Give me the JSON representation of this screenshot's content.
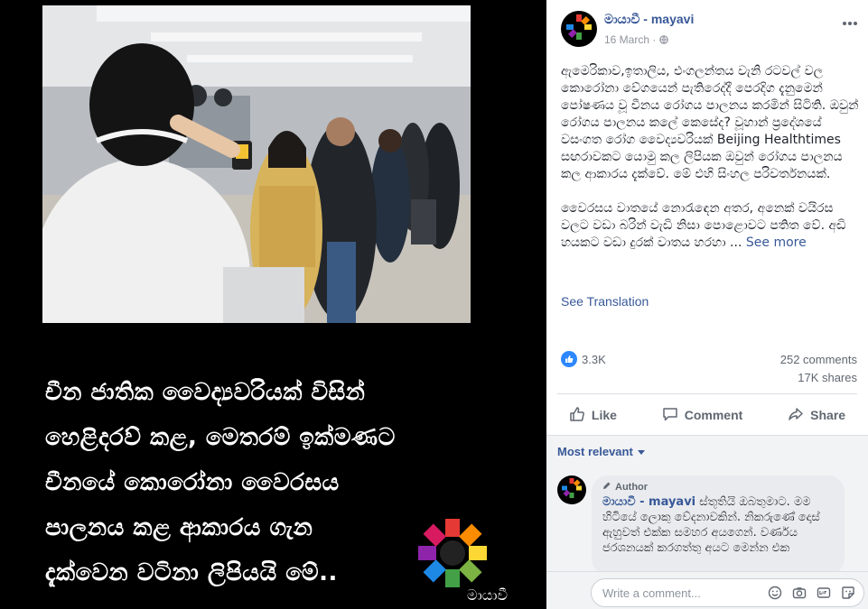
{
  "media": {
    "caption_lines": [
      "චීන ජාතික වෛද්‍යවරියක් විසින්",
      "හෙළිදරව් කළ, මෙතරම් ඉක්මණට",
      "චීනයේ කොරෝනා වෛරසය",
      "පාලනය කළ ආකාරය ගැන",
      "දැක්වෙන වටිනා ලිපියයි මේ.."
    ],
    "logo_text": "මායාවී"
  },
  "post": {
    "author": "මායාවී - mayavi",
    "date": "16 March",
    "more_icon": "more-horizontal-icon",
    "privacy_icon": "globe-icon",
    "paragraphs": [
      "ඇමෙරිකාව,ඉතාලිය, එංගලන්තය වැනි රටවල් වල කොරෝනා වේගයෙන් පැතිරෙද්දී පෙරදිග දැනුමෙන් පෝෂණය වූ චීනය රෝගය පාලනය කරමින් සිටිති. ඔවුන් රෝගය පාලනය කලේ කෙසේද? වූහාන් ප්‍රදේශයේ වසංගත රෝග වෛද්‍යවරියක් Beijing Healthtimes සඟරාවකට යොමු කල ලිපියක ඔවුන් රෝගය පාලනය කල ආකාරය දැක්වේ. මේ එහි සිංහල පරිවර්තනයක්.",
      "වෛරසය වාතයේ නොරැඳෙන අතර, අනෙක් වයිරස වලට වඩා බරින් වැඩි නිසා පොළොවට පතිත වේ. අඩි හයකට වඩා දුරක් වාතය හරහා ..."
    ],
    "see_more": "See more",
    "see_translation": "See Translation",
    "reactions_count": "3.3K",
    "comments_count": "252 comments",
    "shares_count": "17K shares",
    "actions": {
      "like": "Like",
      "comment": "Comment",
      "share": "Share"
    }
  },
  "comments": {
    "sort_label": "Most relevant",
    "items": [
      {
        "badge": "Author",
        "author": "මායාවී - mayavi",
        "text": "ස්තූතියි ඔබතුමාට. මම හිටියේ ලොකු වේදනාවකින්. නිකරුණේ දොස් ඇහුවත් එක්ක සමහර අයගෙන්. වර්ණය ජරශනයක් කරගත්තු අයට මෙන්න එක"
      }
    ],
    "composer_placeholder": "Write a comment...",
    "composer_icons": [
      "emoji-icon",
      "camera-icon",
      "gif-icon",
      "sticker-icon"
    ]
  },
  "colors": {
    "link": "#385898",
    "like_blue": "#2d88ff",
    "text": "#1d2129",
    "muted": "#606770"
  }
}
